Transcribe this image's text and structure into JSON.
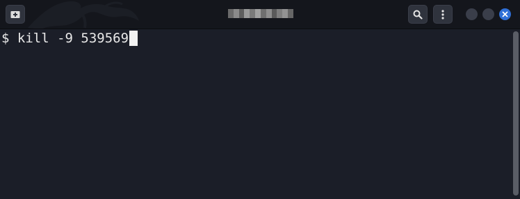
{
  "window": {
    "title_icons": {
      "new_tab": "new-tab-icon",
      "search": "search-icon",
      "menu": "vertical-dots-menu-icon",
      "minimize": "minimize-icon",
      "maximize": "maximize-icon",
      "close": "close-icon"
    },
    "colors": {
      "titlebar": "#14161c",
      "terminal_bg": "#1b1e28",
      "close_button": "#2f6fd6",
      "text": "#e8e8e8"
    }
  },
  "terminal": {
    "prompt": "$ ",
    "command": "kill -9 539569"
  }
}
